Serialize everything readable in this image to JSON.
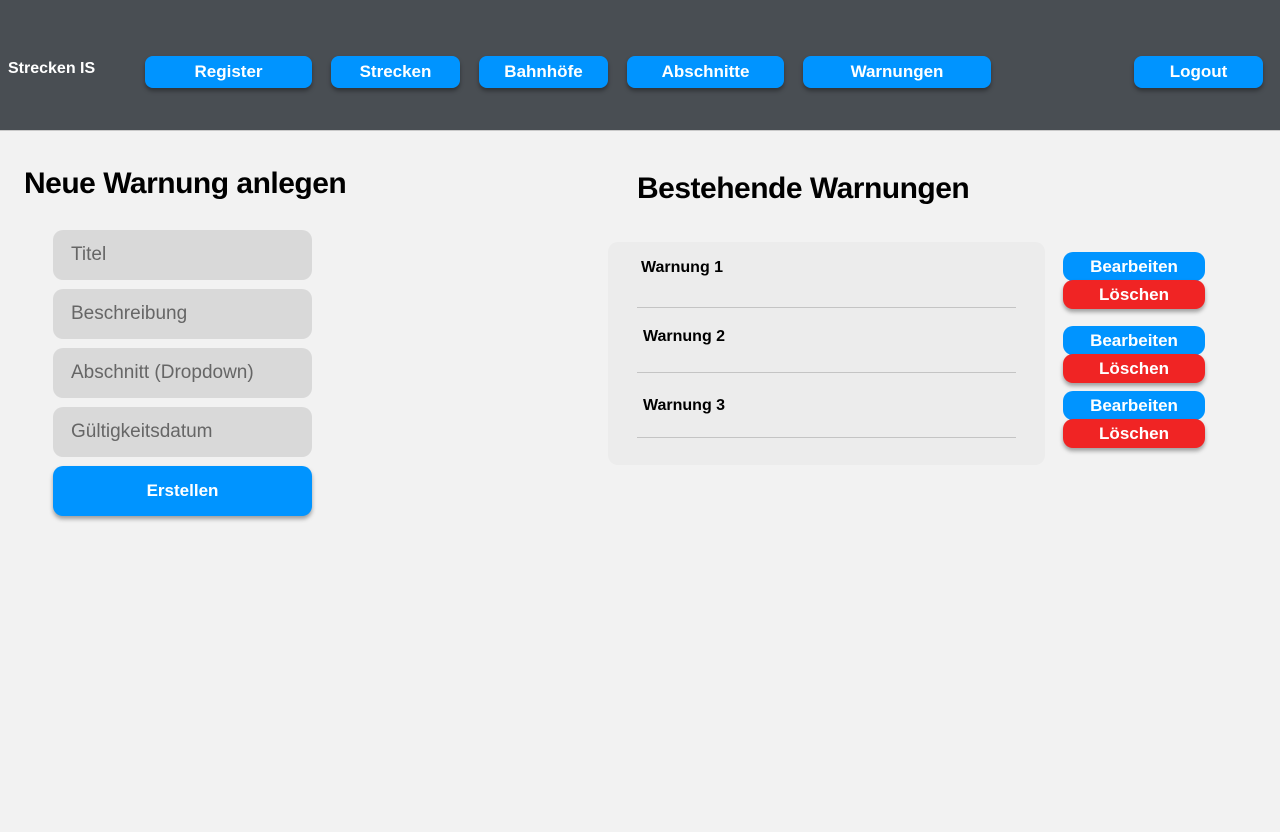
{
  "app": {
    "brand": "Strecken IS",
    "colors": {
      "topbar": "#494e53",
      "primary": "#0094ff",
      "danger": "#f02424",
      "background": "#f2f2f2"
    }
  },
  "nav": {
    "register": "Register",
    "strecken": "Strecken",
    "bahnhoefe": "Bahnhöfe",
    "abschnitte": "Abschnitte",
    "warnungen": "Warnungen",
    "logout": "Logout"
  },
  "form": {
    "title": "Neue Warnung anlegen",
    "fields": {
      "titel": {
        "value": "",
        "placeholder": "Titel"
      },
      "beschreibung": {
        "value": "",
        "placeholder": "Beschreibung"
      },
      "abschnitt": {
        "value": "",
        "placeholder": "Abschnitt (Dropdown)"
      },
      "gueltigkeitsdatum": {
        "value": "",
        "placeholder": "Gültigkeitsdatum"
      }
    },
    "submit": "Erstellen"
  },
  "list": {
    "title": "Bestehende Warnungen",
    "items": [
      {
        "label": "Warnung 1",
        "edit": "Bearbeiten",
        "delete": "Löschen"
      },
      {
        "label": "Warnung 2",
        "edit": "Bearbeiten",
        "delete": "Löschen"
      },
      {
        "label": "Warnung 3",
        "edit": "Bearbeiten",
        "delete": "Löschen"
      }
    ]
  }
}
